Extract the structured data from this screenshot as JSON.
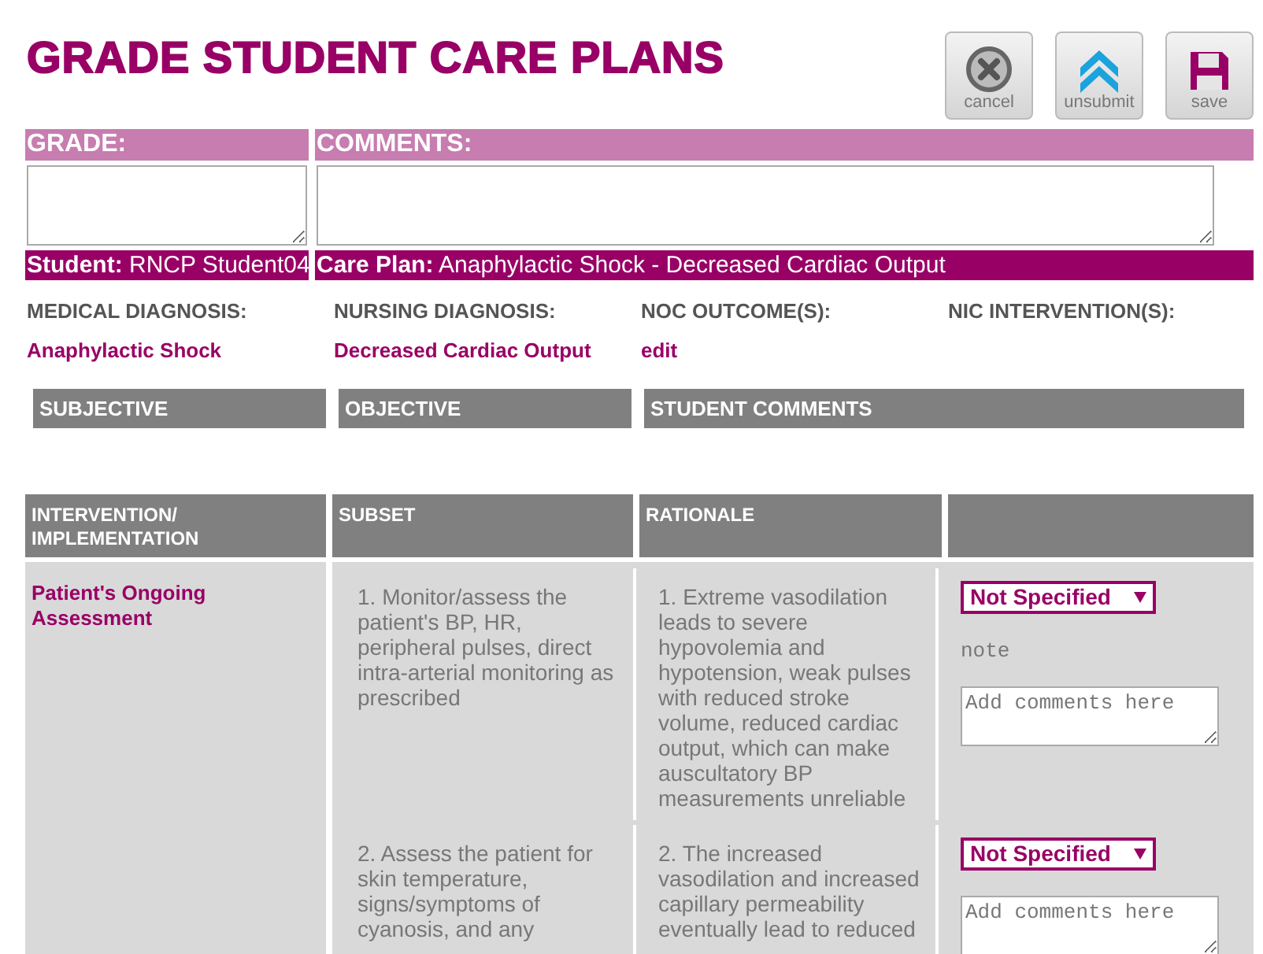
{
  "title": "GRADE STUDENT CARE PLANS",
  "toolbar": [
    {
      "kind": "cancel",
      "label": "cancel"
    },
    {
      "kind": "unsubmit",
      "label": "unsubmit"
    },
    {
      "kind": "save",
      "label": "save"
    }
  ],
  "grade": {
    "label": "GRADE:"
  },
  "comments": {
    "label": "COMMENTS:"
  },
  "student": {
    "label": "Student:",
    "value": "RNCP Student04"
  },
  "care_plan": {
    "label": "Care Plan:",
    "value": "Anaphylactic Shock - Decreased Cardiac Output"
  },
  "diagnoses": [
    {
      "label": "MEDICAL DIAGNOSIS:",
      "value": "Anaphylactic Shock"
    },
    {
      "label": "NURSING DIAGNOSIS:",
      "value": "Decreased Cardiac Output"
    },
    {
      "label": "NOC OUTCOME(S):",
      "value": "edit"
    },
    {
      "label": "NIC INTERVENTION(S):"
    }
  ],
  "notes_headers": [
    "SUBJECTIVE",
    "OBJECTIVE",
    "STUDENT COMMENTS"
  ],
  "table": {
    "columns": [
      "INTERVENTION/ IMPLEMENTATION",
      "SUBSET",
      "RATIONALE"
    ],
    "groups": [
      {
        "title": "Patient's Ongoing Assessment",
        "rows": [
          {
            "subset": "1. Monitor/assess the patient's BP, HR, peripheral pulses, direct intra-arterial monitoring as prescribed",
            "rationale": "1. Extreme vasodilation leads to severe hypovolemia and hypotension, weak pulses with reduced stroke volume, reduced cardiac output, which can make auscultatory BP measurements unreliable",
            "status": "Not Specified",
            "note": "note",
            "comment_placeholder": "Add comments here"
          },
          {
            "subset": "2. Assess the patient for skin temperature, signs/symptoms of cyanosis, and any",
            "rationale": "2. The increased vasodilation and increased capillary permeability eventually lead to reduced",
            "status": "Not Specified",
            "comment_placeholder": "Add comments here"
          }
        ]
      }
    ]
  }
}
